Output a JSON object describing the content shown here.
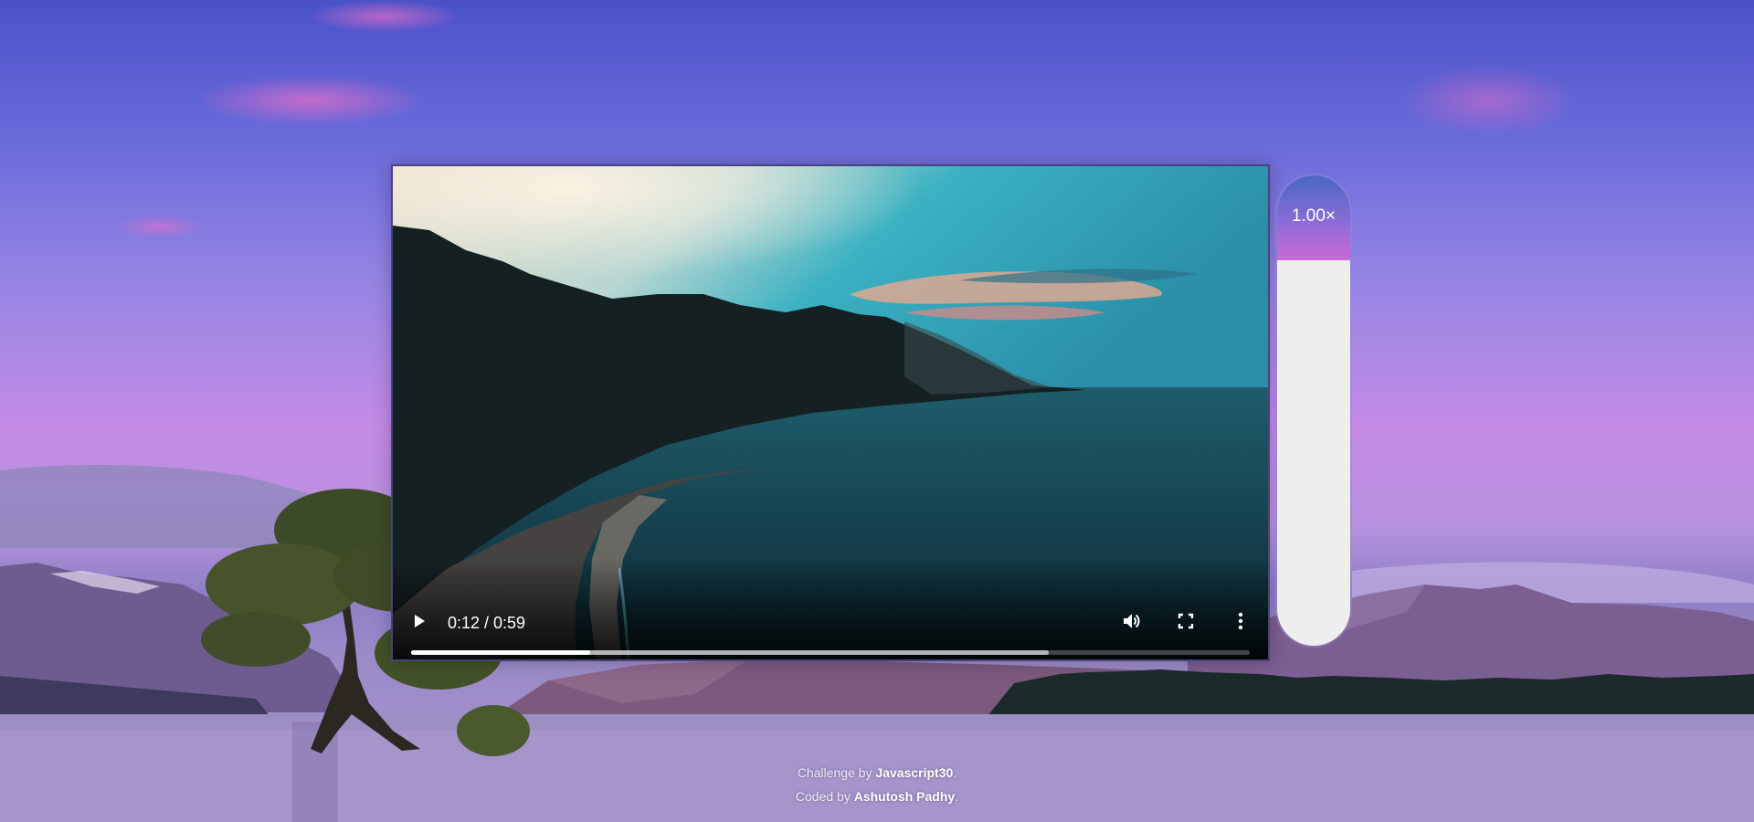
{
  "player": {
    "time_display": "0:12 / 0:59",
    "play_state": "paused",
    "progress": {
      "played_fraction": 0.214,
      "buffered_fraction": 0.76
    },
    "icons": {
      "play": "play-icon",
      "volume": "volume-icon",
      "fullscreen": "fullscreen-icon",
      "more": "more-options-icon"
    }
  },
  "speed_control": {
    "label": "1.00×",
    "fill_fraction": 0.18
  },
  "footer": {
    "line1_prefix": "Challenge by ",
    "line1_link": "Javascript30",
    "line1_suffix": ".",
    "line2_prefix": "Coded by ",
    "line2_link": "Ashutosh Padhy",
    "line2_suffix": "."
  },
  "colors": {
    "speed_bar_top": "#4a67c4",
    "speed_bar_bottom": "#cb6ad6",
    "speed_track": "#efeeef"
  }
}
